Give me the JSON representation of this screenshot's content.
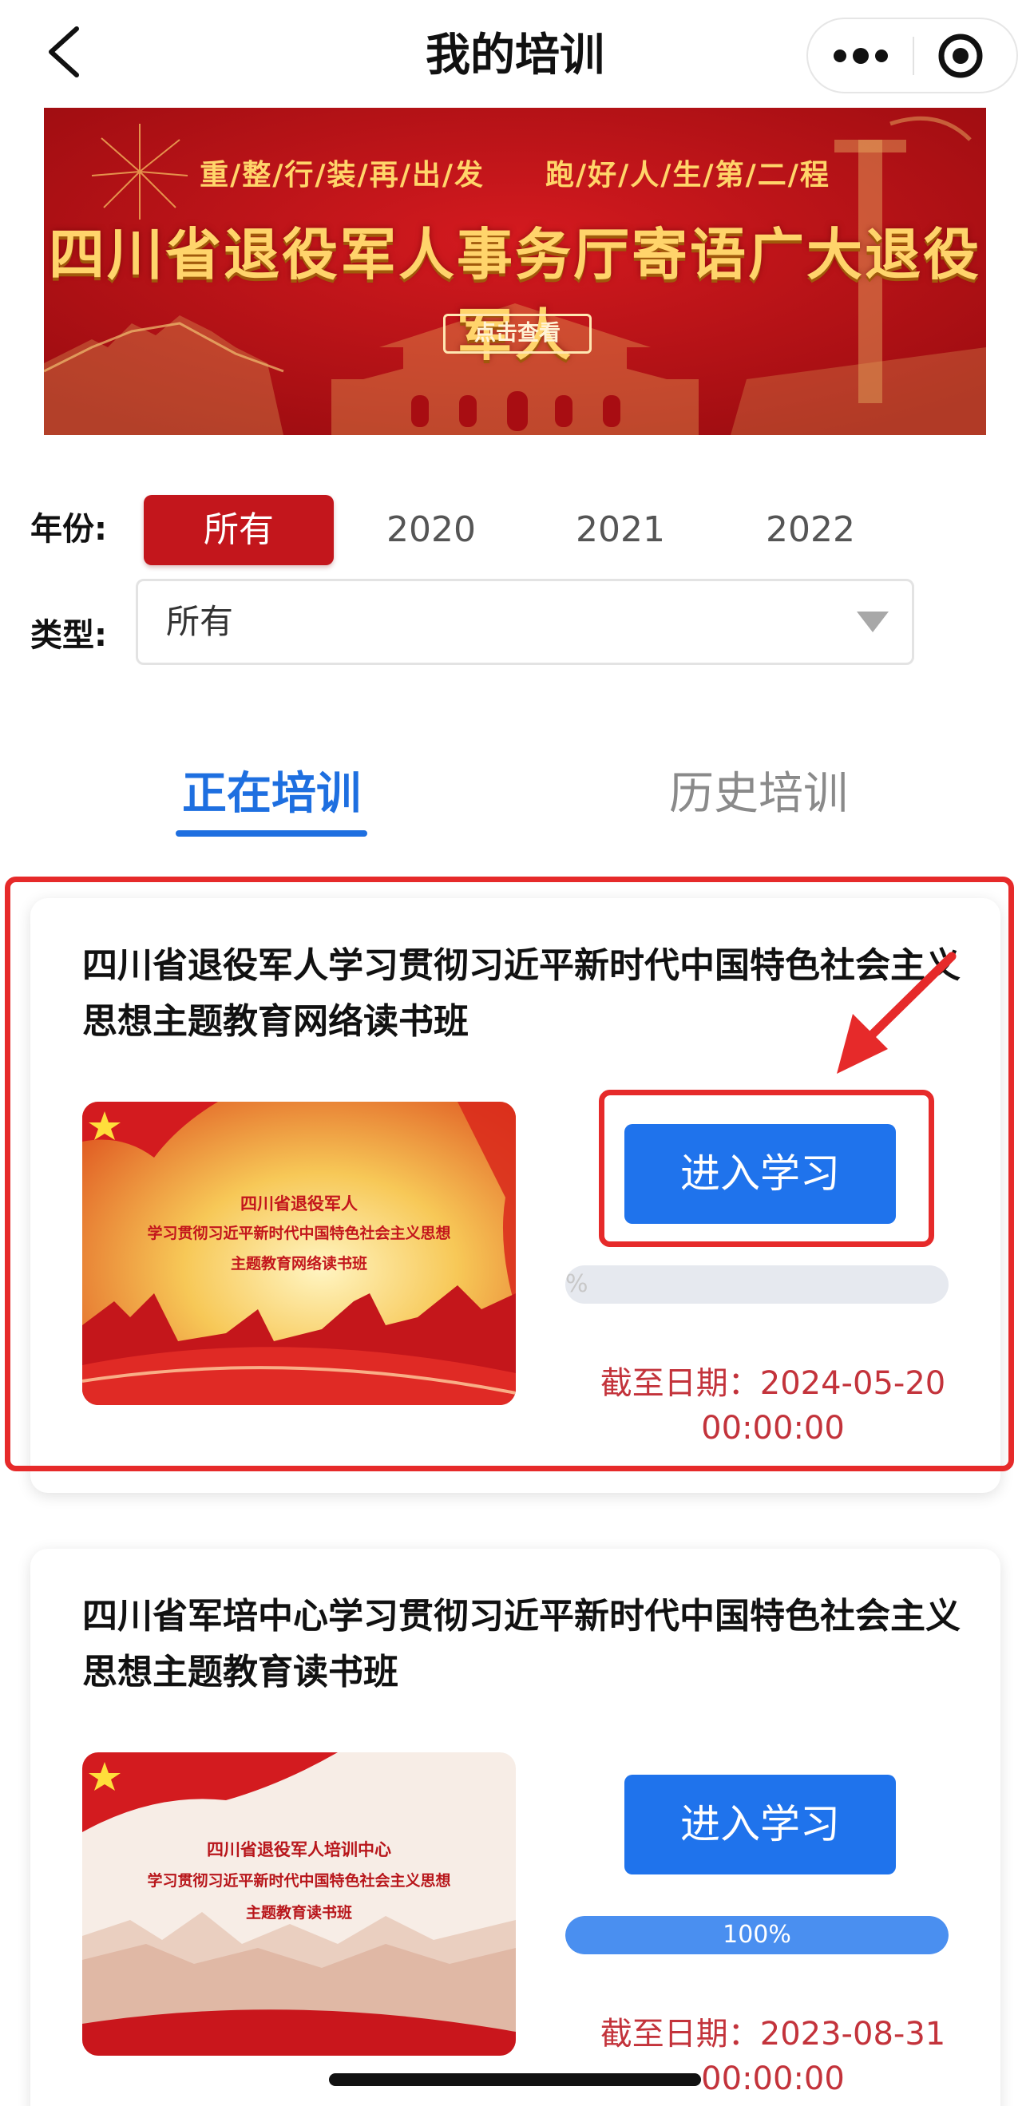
{
  "navbar": {
    "title": "我的培训",
    "back_icon": "chevron-left-icon",
    "more_icon": "more-dots-icon",
    "close_icon": "mini-program-close-icon"
  },
  "banner": {
    "sub_text": "重/整/行/装/再/出/发　　跑/好/人/生/第/二/程",
    "main_text": "四川省退役军人事务厅寄语广大退役军人",
    "button_label": "点击查看"
  },
  "filters": {
    "year_label": "年份:",
    "years": [
      "所有",
      "2020",
      "2021",
      "2022"
    ],
    "selected_year": "所有",
    "type_label": "类型:",
    "type_value": "所有"
  },
  "tabs": [
    {
      "label": "正在培训",
      "active": true
    },
    {
      "label": "历史培训",
      "active": false
    }
  ],
  "courses": [
    {
      "title": "四川省退役军人学习贯彻习近平新时代中国特色社会主义思想主题教育网络读书班",
      "thumb_lines": [
        "四川省退役军人",
        "学习贯彻习近平新时代中国特色社会主义思想",
        "主题教育网络读书班"
      ],
      "enter_label": "进入学习",
      "progress": 0,
      "progress_label": "%",
      "deadline_label": "截至日期：2024-05-20",
      "deadline_time": "00:00:00"
    },
    {
      "title": "四川省军培中心学习贯彻习近平新时代中国特色社会主义思想主题教育读书班",
      "thumb_lines": [
        "四川省退役军人培训中心",
        "学习贯彻习近平新时代中国特色社会主义思想",
        "主题教育读书班"
      ],
      "enter_label": "进入学习",
      "progress": 100,
      "progress_label": "100%",
      "deadline_label": "截至日期：2023-08-31",
      "deadline_time": "00:00:00"
    }
  ],
  "colors": {
    "accent_blue": "#1f73ec",
    "brand_red": "#c3161c",
    "annotation_red": "#e62a2a"
  }
}
